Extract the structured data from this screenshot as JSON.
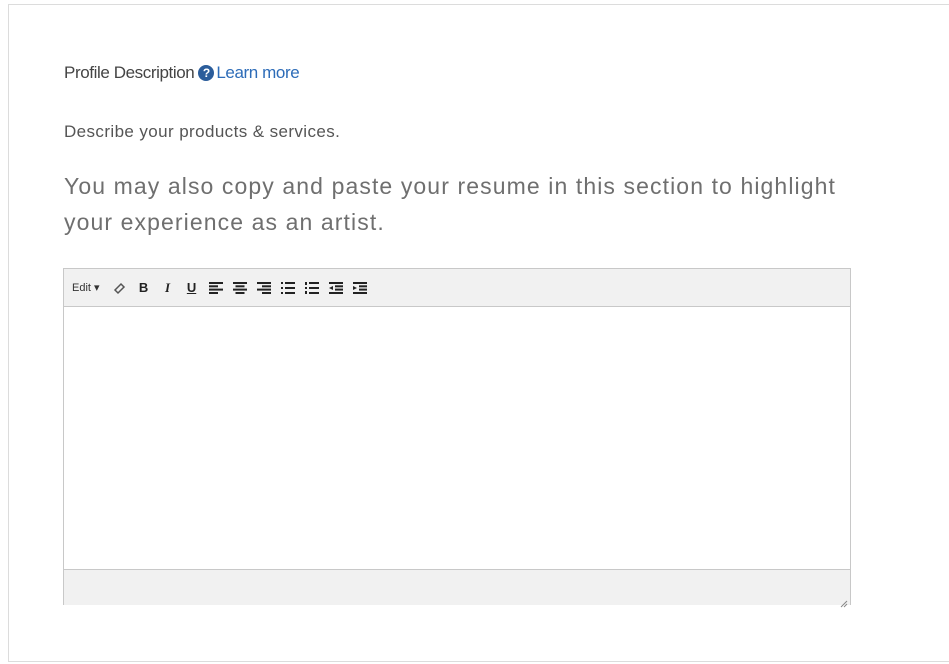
{
  "field": {
    "label": "Profile Description",
    "help_icon": "question-circle-icon",
    "learn_more": "Learn more",
    "subheading": "Describe your products & services.",
    "description": "You may also copy and paste your resume in this section to highlight your experience as an artist."
  },
  "editor": {
    "menu_edit": "Edit",
    "tools": [
      "eraser-icon",
      "bold-icon",
      "italic-icon",
      "underline-icon",
      "align-left-icon",
      "align-center-icon",
      "align-right-icon",
      "bullet-list-icon",
      "numbered-list-icon",
      "outdent-icon",
      "indent-icon"
    ],
    "content": ""
  },
  "colors": {
    "link": "#2d6cb8",
    "help_icon": "#2b5d9b",
    "toolbar_bg": "#f1f1f1",
    "border": "#c8c8c8"
  }
}
